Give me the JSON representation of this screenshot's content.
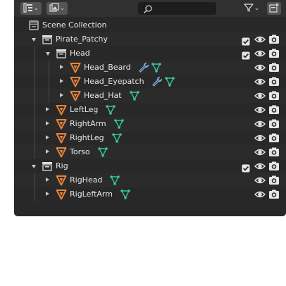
{
  "header": {
    "display_mode_icon": "outliner-display-mode-icon",
    "view_icon": "image-view-icon",
    "filter_icon": "funnel-filter-icon",
    "new_collection_icon": "new-collection-icon",
    "search": {
      "value": "",
      "placeholder": ""
    }
  },
  "colors": {
    "panel_bg": "#282828",
    "row_alt": "#2b2b2b",
    "mesh_orange": "#e8833a",
    "vertex_green": "#3bc59a",
    "modifier_blue": "#7aa7de",
    "text": "#e6e6e6"
  },
  "tree": [
    {
      "id": "scene_collection",
      "label": "Scene Collection",
      "kind": "scene",
      "depth": 0,
      "disclosure": "none",
      "modifier": false,
      "vertex_group": false,
      "checkbox": false,
      "eye": false,
      "camera": false
    },
    {
      "id": "pirate_patchy",
      "label": "Pirate_Patchy",
      "kind": "collection",
      "depth": 1,
      "disclosure": "open",
      "modifier": false,
      "vertex_group": false,
      "checkbox": true,
      "eye": true,
      "camera": true
    },
    {
      "id": "head",
      "label": "Head",
      "kind": "collection",
      "depth": 2,
      "disclosure": "open",
      "modifier": false,
      "vertex_group": false,
      "checkbox": true,
      "eye": true,
      "camera": true
    },
    {
      "id": "head_beard",
      "label": "Head_Beard",
      "kind": "mesh",
      "depth": 3,
      "disclosure": "closed",
      "modifier": true,
      "vertex_group": true,
      "checkbox": false,
      "eye": true,
      "camera": true
    },
    {
      "id": "head_eyepatch",
      "label": "Head_Eyepatch",
      "kind": "mesh",
      "depth": 3,
      "disclosure": "closed",
      "modifier": true,
      "vertex_group": true,
      "checkbox": false,
      "eye": true,
      "camera": true
    },
    {
      "id": "head_hat",
      "label": "Head_Hat",
      "kind": "mesh",
      "depth": 3,
      "disclosure": "closed",
      "modifier": false,
      "vertex_group": true,
      "checkbox": false,
      "eye": true,
      "camera": true
    },
    {
      "id": "leftleg",
      "label": "LeftLeg",
      "kind": "mesh",
      "depth": 2,
      "disclosure": "closed",
      "modifier": false,
      "vertex_group": true,
      "checkbox": false,
      "eye": true,
      "camera": true
    },
    {
      "id": "rightarm",
      "label": "RightArm",
      "kind": "mesh",
      "depth": 2,
      "disclosure": "closed",
      "modifier": false,
      "vertex_group": true,
      "checkbox": false,
      "eye": true,
      "camera": true
    },
    {
      "id": "rightleg",
      "label": "RightLeg",
      "kind": "mesh",
      "depth": 2,
      "disclosure": "closed",
      "modifier": false,
      "vertex_group": true,
      "checkbox": false,
      "eye": true,
      "camera": true
    },
    {
      "id": "torso",
      "label": "Torso",
      "kind": "mesh",
      "depth": 2,
      "disclosure": "closed",
      "modifier": false,
      "vertex_group": true,
      "checkbox": false,
      "eye": true,
      "camera": true
    },
    {
      "id": "rig",
      "label": "Rig",
      "kind": "collection",
      "depth": 1,
      "disclosure": "open",
      "modifier": false,
      "vertex_group": false,
      "checkbox": true,
      "eye": true,
      "camera": true
    },
    {
      "id": "righead",
      "label": "RigHead",
      "kind": "mesh",
      "depth": 2,
      "disclosure": "closed",
      "modifier": false,
      "vertex_group": true,
      "checkbox": false,
      "eye": true,
      "camera": true
    },
    {
      "id": "rigleftarm",
      "label": "RigLeftArm",
      "kind": "mesh",
      "depth": 2,
      "disclosure": "closed",
      "modifier": false,
      "vertex_group": true,
      "checkbox": false,
      "eye": true,
      "camera": true
    }
  ]
}
